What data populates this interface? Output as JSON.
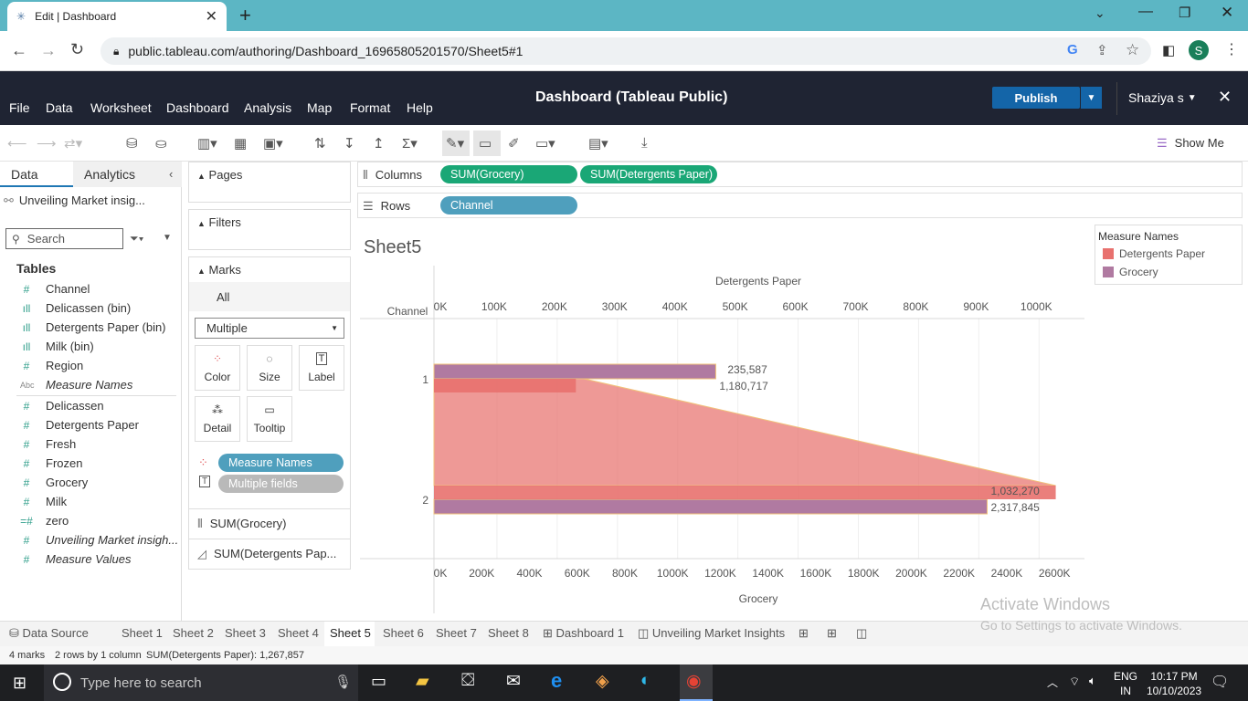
{
  "browser": {
    "tab_title": "Edit | Dashboard",
    "url": "public.tableau.com/authoring/Dashboard_16965805201570/Sheet5#1",
    "profile_initial": "S"
  },
  "header": {
    "menus": [
      "File",
      "Data",
      "Worksheet",
      "Dashboard",
      "Analysis",
      "Map",
      "Format",
      "Help"
    ],
    "title": "Dashboard (Tableau Public)",
    "publish": "Publish",
    "user": "Shaziya s"
  },
  "toolbar": {
    "show_me": "Show Me"
  },
  "datapane": {
    "tabs": [
      "Data",
      "Analytics"
    ],
    "source": "Unveiling Market insig...",
    "search_placeholder": "Search",
    "tables_heading": "Tables",
    "fields": [
      {
        "icon": "#",
        "label": "Channel",
        "italic": false
      },
      {
        "icon": "bin",
        "label": "Delicassen (bin)",
        "italic": false
      },
      {
        "icon": "bin",
        "label": "Detergents Paper (bin)",
        "italic": false
      },
      {
        "icon": "bin",
        "label": "Milk (bin)",
        "italic": false
      },
      {
        "icon": "#",
        "label": "Region",
        "italic": false
      },
      {
        "icon": "Abc",
        "label": "Measure Names",
        "italic": true
      },
      {
        "icon": "#",
        "label": "Delicassen",
        "italic": false
      },
      {
        "icon": "#",
        "label": "Detergents Paper",
        "italic": false
      },
      {
        "icon": "#",
        "label": "Fresh",
        "italic": false
      },
      {
        "icon": "#",
        "label": "Frozen",
        "italic": false
      },
      {
        "icon": "#",
        "label": "Grocery",
        "italic": false
      },
      {
        "icon": "#",
        "label": "Milk",
        "italic": false
      },
      {
        "icon": "=#",
        "label": "zero",
        "italic": false
      },
      {
        "icon": "#",
        "label": "Unveiling Market insigh...",
        "italic": true
      },
      {
        "icon": "#",
        "label": "Measure Values",
        "italic": true
      }
    ]
  },
  "shelves": {
    "pages": "Pages",
    "filters": "Filters",
    "marks": "Marks",
    "marks_all": "All",
    "mark_type": "Multiple",
    "mark_buttons": [
      "Color",
      "Size",
      "Label",
      "Detail",
      "Tooltip"
    ],
    "color_pill": "Measure Names",
    "label_pill": "Multiple fields",
    "sub_marks": [
      "SUM(Grocery)",
      "SUM(Detergents Pap..."
    ],
    "columns_label": "Columns",
    "rows_label": "Rows",
    "columns_pills": [
      "SUM(Grocery)",
      "SUM(Detergents Paper)"
    ],
    "rows_pills": [
      "Channel"
    ]
  },
  "sheet": {
    "title": "Sheet5"
  },
  "legend": {
    "title": "Measure Names",
    "items": [
      {
        "label": "Detergents Paper",
        "color": "#e8716e"
      },
      {
        "label": "Grocery",
        "color": "#b07aa1"
      }
    ]
  },
  "chart_data": {
    "type": "bar",
    "row_header": "Channel",
    "categories": [
      "1",
      "2"
    ],
    "series": [
      {
        "name": "Grocery",
        "values": [
          1180717,
          2317845
        ],
        "color": "#b07aa1"
      },
      {
        "name": "Detergents Paper",
        "values": [
          235587,
          1032270
        ],
        "color": "#e8716e"
      }
    ],
    "data_labels": [
      [
        "235,587",
        "1,180,717"
      ],
      [
        "1,032,270",
        "2,317,845"
      ]
    ],
    "top_axis": {
      "label": "Detergents Paper",
      "range": [
        0,
        1050000
      ],
      "ticks": [
        "0K",
        "100K",
        "200K",
        "300K",
        "400K",
        "500K",
        "600K",
        "700K",
        "800K",
        "900K",
        "1000K"
      ]
    },
    "bottom_axis": {
      "label": "Grocery",
      "range": [
        0,
        2650000
      ],
      "ticks": [
        "0K",
        "200K",
        "400K",
        "600K",
        "800K",
        "1000K",
        "1200K",
        "1400K",
        "1600K",
        "1800K",
        "2000K",
        "2200K",
        "2400K",
        "2600K"
      ]
    }
  },
  "sheettabs": [
    "Data Source",
    "Sheet 1",
    "Sheet 2",
    "Sheet 3",
    "Sheet 4",
    "Sheet 5",
    "Sheet 6",
    "Sheet 7",
    "Sheet 8",
    "Dashboard 1",
    "Unveiling Market Insights"
  ],
  "active_tab": "Sheet 5",
  "status": {
    "marks": "4 marks",
    "dims": "2 rows by 1 column",
    "sum": "SUM(Detergents Paper): 1,267,857"
  },
  "watermark": {
    "line1": "Activate Windows",
    "line2": "Go to Settings to activate Windows."
  },
  "taskbar": {
    "search_placeholder": "Type here to search",
    "lang1": "ENG",
    "lang2": "IN",
    "time": "10:17 PM",
    "date": "10/10/2023"
  }
}
